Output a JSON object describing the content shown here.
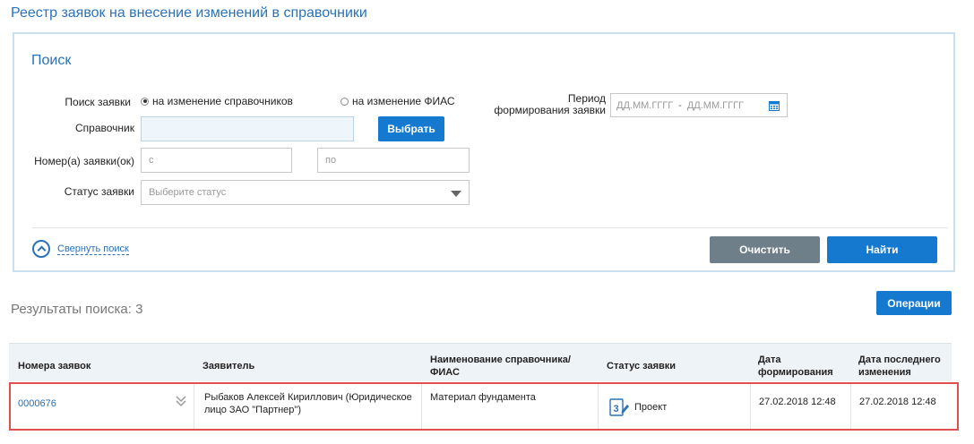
{
  "page": {
    "title": "Реестр заявок на внесение изменений в справочники"
  },
  "search": {
    "title": "Поиск",
    "request_search_label": "Поиск заявки",
    "radio_options": [
      "на изменение справочников",
      "на изменение ФИАС"
    ],
    "selected_radio": 0,
    "directory_label": "Справочник",
    "directory_value": "",
    "choose_button": "Выбрать",
    "numbers_label": "Номер(а) заявки(ок)",
    "number_from_placeholder": "с",
    "number_to_placeholder": "по",
    "status_label": "Статус заявки",
    "status_placeholder": "Выберите статус",
    "period_label_line1": "Период",
    "period_label_line2": "формирования заявки",
    "date_from_placeholder": "ДД.ММ.ГГГГ",
    "date_separator": "-",
    "date_to_placeholder": "ДД.ММ.ГГГГ",
    "collapse_link": "Свернуть поиск",
    "clear_button": "Очистить",
    "find_button": "Найти"
  },
  "results": {
    "label": "Результаты поиска: 3",
    "operations_button": "Операции",
    "columns": [
      "Номера заявок",
      "Заявитель",
      "Наименование справочника/ ФИАС",
      "Статус заявки",
      "Дата формирования",
      "Дата последнего изменения"
    ],
    "rows": [
      {
        "number": "0000676",
        "applicant": "Рыбаков Алексей Кириллович (Юридическое лицо ЗАО \"Партнер\")",
        "directory": "Материал фундамента",
        "status": "Проект",
        "created": "27.02.2018 12:48",
        "modified": "27.02.2018 12:48"
      }
    ]
  },
  "colors": {
    "accent": "#1479cf",
    "title": "#2b72b5",
    "gray_button": "#6f7f89",
    "highlight_border": "#e05050"
  }
}
